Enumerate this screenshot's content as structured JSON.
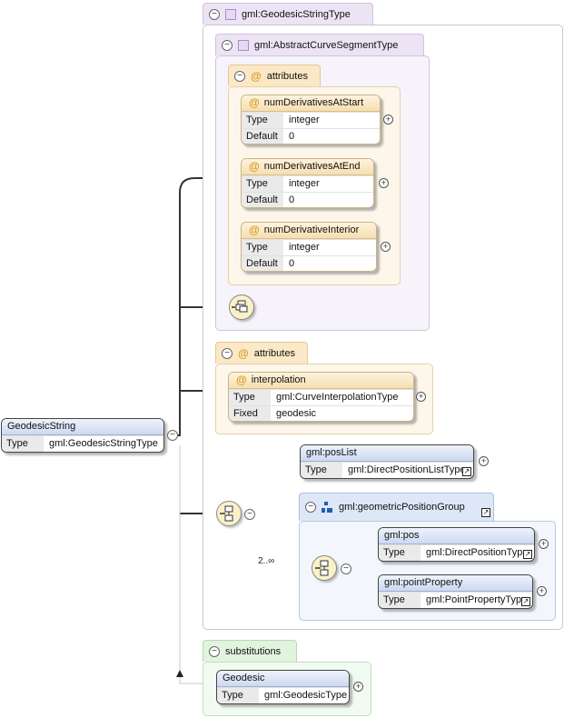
{
  "root_element": {
    "name": "GeodesicString",
    "type_key": "Type",
    "type_value": "gml:GeodesicStringType"
  },
  "geodesic_string_type": {
    "label": "gml:GeodesicStringType"
  },
  "abstract_curve_segment_type": {
    "label": "gml:AbstractCurveSegmentType"
  },
  "inherited_attributes": {
    "label": "attributes",
    "items": [
      {
        "name": "numDerivativesAtStart",
        "type_key": "Type",
        "type_value": "integer",
        "default_key": "Default",
        "default_value": "0"
      },
      {
        "name": "numDerivativesAtEnd",
        "type_key": "Type",
        "type_value": "integer",
        "default_key": "Default",
        "default_value": "0"
      },
      {
        "name": "numDerivativeInterior",
        "type_key": "Type",
        "type_value": "integer",
        "default_key": "Default",
        "default_value": "0"
      }
    ]
  },
  "own_attributes": {
    "label": "attributes",
    "interpolation": {
      "name": "interpolation",
      "type_key": "Type",
      "type_value": "gml:CurveInterpolationType",
      "fixed_key": "Fixed",
      "fixed_value": "geodesic"
    }
  },
  "pos_list": {
    "name": "gml:posList",
    "type_key": "Type",
    "type_value": "gml:DirectPositionListType"
  },
  "geometric_position_group": {
    "label": "gml:geometricPositionGroup",
    "cardinality": "2..∞",
    "pos": {
      "name": "gml:pos",
      "type_key": "Type",
      "type_value": "gml:DirectPositionType"
    },
    "point_property": {
      "name": "gml:pointProperty",
      "type_key": "Type",
      "type_value": "gml:PointPropertyType"
    }
  },
  "substitutions": {
    "label": "substitutions",
    "geodesic": {
      "name": "Geodesic",
      "type_key": "Type",
      "type_value": "gml:GeodesicType"
    }
  },
  "colors": {
    "line": "#333333",
    "compositor_fill": "#fbf1c8",
    "header_blue": "#cdd9f1",
    "attr_orange": "#f6deb0"
  },
  "icons": {
    "collapse": "−",
    "expand": "+",
    "reference": "↗",
    "attribute": "@"
  }
}
